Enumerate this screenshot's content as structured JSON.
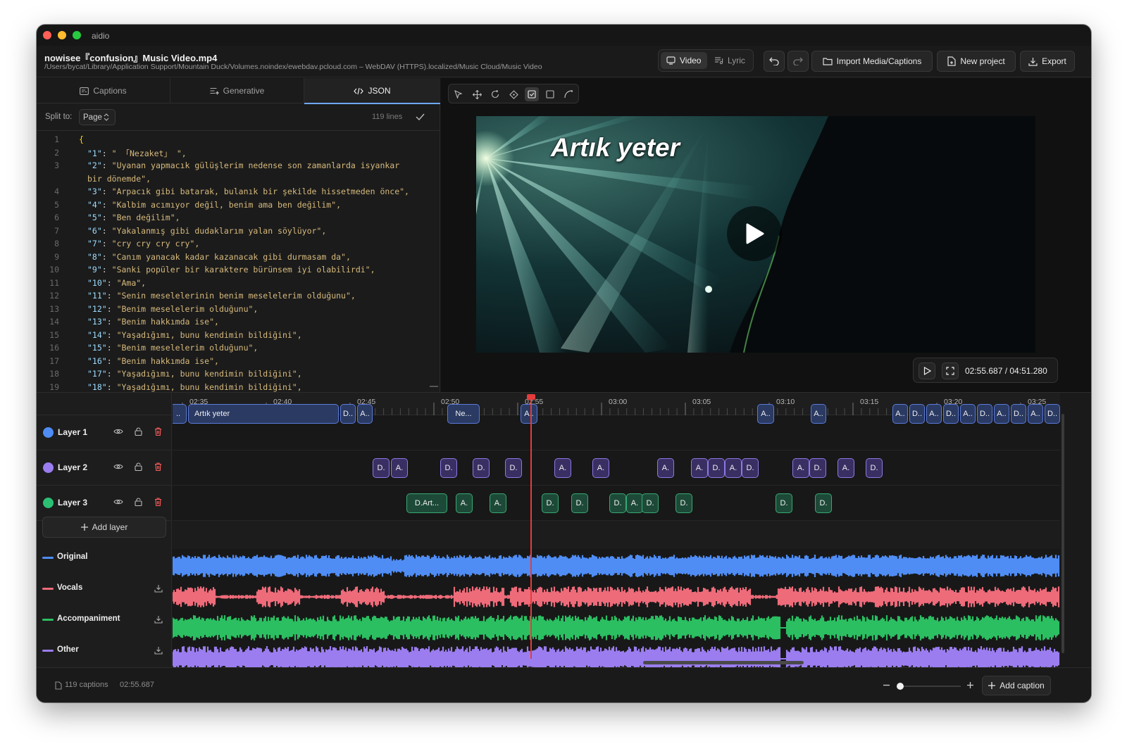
{
  "app": {
    "title": "aidio"
  },
  "file": {
    "name": "nowisee『confusion』Music Video.mp4",
    "path": "/Users/bycat/Library/Application Support/Mountain Duck/Volumes.noindex/ewebdav.pcloud.com – WebDAV (HTTPS).localized/Music Cloud/Music Video"
  },
  "header": {
    "mode_video": "Video",
    "mode_lyric": "Lyric",
    "import_label": "Import Media/Captions",
    "new_project_label": "New project",
    "export_label": "Export"
  },
  "tabs": [
    {
      "label": "Captions"
    },
    {
      "label": "Generative"
    },
    {
      "label": "JSON"
    }
  ],
  "editor": {
    "split_label": "Split to:",
    "split_value": "Page",
    "line_count": "119 lines"
  },
  "json_lines": [
    {
      "n": "1",
      "key": "",
      "val": "{"
    },
    {
      "n": "2",
      "key": "\"1\"",
      "val": "\" 「Nezaket」 \","
    },
    {
      "n": "3",
      "key": "\"2\"",
      "val": "\"Uyanan yapmacık gülüşlerim nedense son zamanlarda isyankar"
    },
    {
      "n": "",
      "key": "",
      "val": "bir dönemde\","
    },
    {
      "n": "4",
      "key": "\"3\"",
      "val": "\"Arpacık gibi batarak, bulanık bir şekilde hissetmeden önce\","
    },
    {
      "n": "5",
      "key": "\"4\"",
      "val": "\"Kalbim acımıyor değil, benim ama ben değilim\","
    },
    {
      "n": "6",
      "key": "\"5\"",
      "val": "\"Ben değilim\","
    },
    {
      "n": "7",
      "key": "\"6\"",
      "val": "\"Yakalanmış gibi dudaklarım yalan söylüyor\","
    },
    {
      "n": "8",
      "key": "\"7\"",
      "val": "\"cry cry cry cry\","
    },
    {
      "n": "9",
      "key": "\"8\"",
      "val": "\"Canım yanacak kadar kazanacak gibi durmasam da\","
    },
    {
      "n": "10",
      "key": "\"9\"",
      "val": "\"Sanki popüler bir karaktere bürünsem iyi olabilirdi\","
    },
    {
      "n": "11",
      "key": "\"10\"",
      "val": "\"Ama\","
    },
    {
      "n": "12",
      "key": "\"11\"",
      "val": "\"Senin meselelerinin benim meselelerim olduğunu\","
    },
    {
      "n": "13",
      "key": "\"12\"",
      "val": "\"Benim meselelerim olduğunu\","
    },
    {
      "n": "14",
      "key": "\"13\"",
      "val": "\"Benim hakkımda ise\","
    },
    {
      "n": "15",
      "key": "\"14\"",
      "val": "\"Yaşadığımı, bunu kendimin bildiğini\","
    },
    {
      "n": "16",
      "key": "\"15\"",
      "val": "\"Benim meselelerim olduğunu\","
    },
    {
      "n": "17",
      "key": "\"16\"",
      "val": "\"Benim hakkımda ise\","
    },
    {
      "n": "18",
      "key": "\"17\"",
      "val": "\"Yaşadığımı, bunu kendimin bildiğini\","
    },
    {
      "n": "19",
      "key": "\"18\"",
      "val": "\"Yaşadığımı, bunu kendimin bildiğini\","
    }
  ],
  "video": {
    "caption": "Artık yeter",
    "time": "02:55.687 / 04:51.280"
  },
  "layers": [
    {
      "name": "Layer 1",
      "color": "#4f8df5"
    },
    {
      "name": "Layer 2",
      "color": "#9b7df0"
    },
    {
      "name": "Layer 3",
      "color": "#2bbf73"
    }
  ],
  "add_layer_label": "Add layer",
  "audio_tracks": [
    {
      "name": "Original",
      "color": "#4f8df5"
    },
    {
      "name": "Vocals",
      "color": "#ee6b7a"
    },
    {
      "name": "Accompaniment",
      "color": "#2bbf62"
    },
    {
      "name": "Other",
      "color": "#9b7df0"
    }
  ],
  "ruler_labels": [
    "02:35",
    "02:40",
    "02:45",
    "02:50",
    "02:55",
    "03:00",
    "03:05",
    "03:10",
    "03:15",
    "03:20",
    "03:25"
  ],
  "clips": {
    "layer1": [
      "..",
      "Artık yeter",
      "D..",
      "A..",
      "Ne...",
      "A..",
      "A..",
      "A..",
      "A..",
      "D..",
      "A..",
      "D..",
      "A..",
      "D..",
      "A..",
      "D..",
      "A..",
      "D.."
    ],
    "layer2": [
      "D.",
      "A.",
      "D.",
      "D.",
      "D.",
      "A.",
      "A.",
      "A.",
      "A.",
      "D.",
      "A.",
      "D.",
      "A.",
      "D.",
      "A.",
      "D."
    ],
    "layer3": [
      "D.Art...",
      "A.",
      "A.",
      "D.",
      "D.",
      "D.",
      "A.",
      "D.",
      "D.",
      "D.",
      "D."
    ]
  },
  "status": {
    "captions_count": "119 captions",
    "time": "02:55.687",
    "add_caption_label": "Add caption"
  }
}
